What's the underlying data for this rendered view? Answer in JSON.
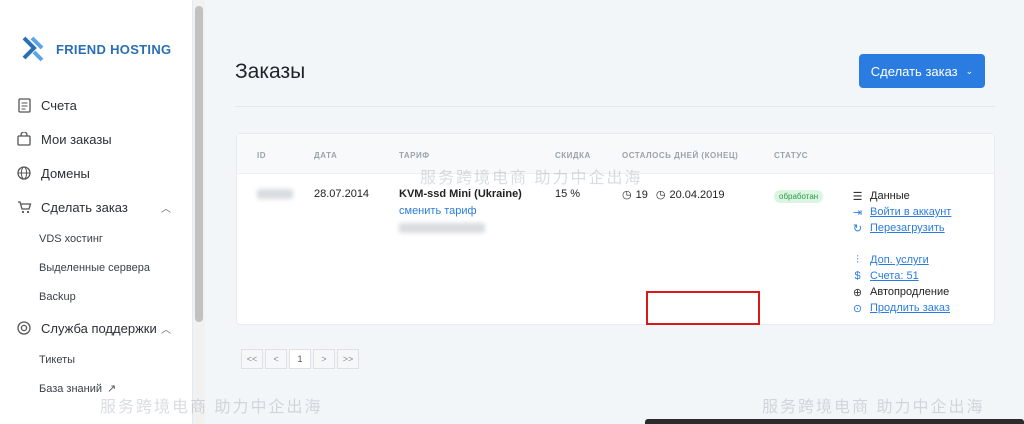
{
  "brand": {
    "name": "FRIEND HOSTING"
  },
  "sidebar": {
    "items": [
      {
        "label": "Счета",
        "icon": "document-icon"
      },
      {
        "label": "Мои заказы",
        "icon": "bag-icon"
      },
      {
        "label": "Домены",
        "icon": "globe-icon"
      },
      {
        "label": "Сделать заказ",
        "icon": "cart-icon",
        "expanded": true,
        "children": [
          "VDS хостинг",
          "Выделенные сервера",
          "Backup"
        ]
      },
      {
        "label": "Служба поддержки",
        "icon": "support-icon",
        "expanded": true,
        "children": [
          "Тикеты",
          "База знаний"
        ]
      }
    ]
  },
  "page": {
    "title": "Заказы",
    "order_button": "Сделать заказ"
  },
  "table": {
    "headers": [
      "ID",
      "ДАТА",
      "ТАРИФ",
      "СКИДКА",
      "ОСТАЛОСЬ ДНЕЙ (КОНЕЦ)",
      "СТАТУС"
    ],
    "row": {
      "date": "28.07.2014",
      "tariff": "KVM-ssd Mini (Ukraine)",
      "change_tariff": "сменить тариф",
      "discount": "15 %",
      "days_left": "19",
      "end_date": "20.04.2019",
      "status": "обработан"
    }
  },
  "actions": {
    "data": "Данные",
    "login": "Войти в аккаунт",
    "reboot": "Перезагрузить",
    "extra": "Доп. услуги",
    "invoices": "Счета: 51",
    "autorenew": "Автопродление",
    "extend": "Продлить заказ"
  },
  "pagination": {
    "first": "<<",
    "prev": "<",
    "current": "1",
    "next": ">",
    "last": ">>"
  },
  "watermark": {
    "text": "服务跨境电商 助力中企出海"
  },
  "colors": {
    "accent": "#2a7ce0",
    "highlight": "#d9181c",
    "status_bg": "#dcf5e2"
  }
}
